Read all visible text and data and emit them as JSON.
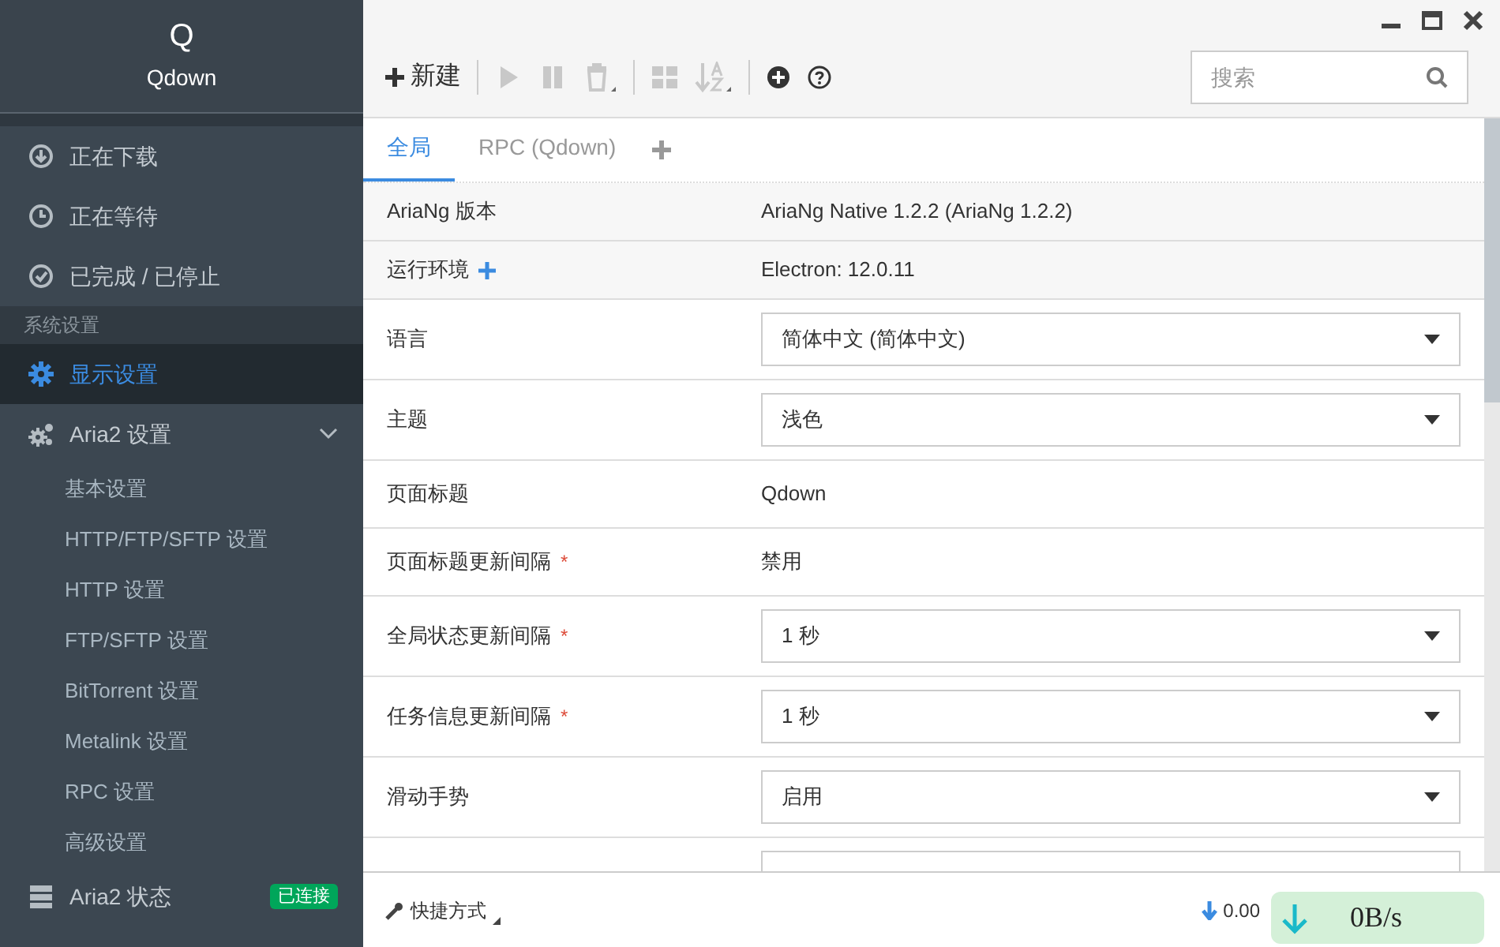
{
  "app": {
    "logo": "Q",
    "name": "Qdown"
  },
  "sidebar": {
    "items": [
      {
        "label": "正在下载",
        "selected": false
      },
      {
        "label": "正在等待",
        "selected": false
      },
      {
        "label": "已完成 / 已停止",
        "selected": false
      }
    ],
    "section": "系统设置",
    "settings": [
      {
        "label": "显示设置",
        "selected": true
      },
      {
        "label": "Aria2 设置",
        "selected": false,
        "expanded": true,
        "children": [
          {
            "label": "基本设置"
          },
          {
            "label": "HTTP/FTP/SFTP 设置"
          },
          {
            "label": "HTTP 设置"
          },
          {
            "label": "FTP/SFTP 设置"
          },
          {
            "label": "BitTorrent 设置"
          },
          {
            "label": "Metalink 设置"
          },
          {
            "label": "RPC 设置"
          },
          {
            "label": "高级设置"
          }
        ]
      },
      {
        "label": "Aria2 状态",
        "selected": false,
        "badge": "已连接"
      }
    ]
  },
  "toolbar": {
    "new_label": "新建",
    "search": {
      "placeholder": "搜索"
    }
  },
  "tabs": [
    {
      "label": "全局",
      "selected": true
    },
    {
      "label": "RPC (Qdown)",
      "selected": false
    }
  ],
  "settings_rows": [
    {
      "kind": "text",
      "label": "AriaNg 版本",
      "value": "AriaNg Native 1.2.2 (AriaNg 1.2.2)"
    },
    {
      "kind": "text",
      "label": "运行环境",
      "value": "Electron: 12.0.11",
      "expandable": true
    },
    {
      "kind": "select",
      "label": "语言",
      "value": "简体中文 (简体中文)"
    },
    {
      "kind": "select",
      "label": "主题",
      "value": "浅色"
    },
    {
      "kind": "text",
      "label": "页面标题",
      "value": "Qdown"
    },
    {
      "kind": "text",
      "label": "页面标题更新间隔",
      "value": "禁用",
      "required_mark": "*"
    },
    {
      "kind": "select",
      "label": "全局状态更新间隔",
      "value": "1 秒",
      "required_mark": "*"
    },
    {
      "kind": "select",
      "label": "任务信息更新间隔",
      "value": "1 秒",
      "required_mark": "*"
    },
    {
      "kind": "select",
      "label": "滑动手势",
      "value": "启用"
    }
  ],
  "footer": {
    "shortcut_label": "快捷方式",
    "speed_small": "0.00",
    "speed_widget": "0B/s"
  }
}
